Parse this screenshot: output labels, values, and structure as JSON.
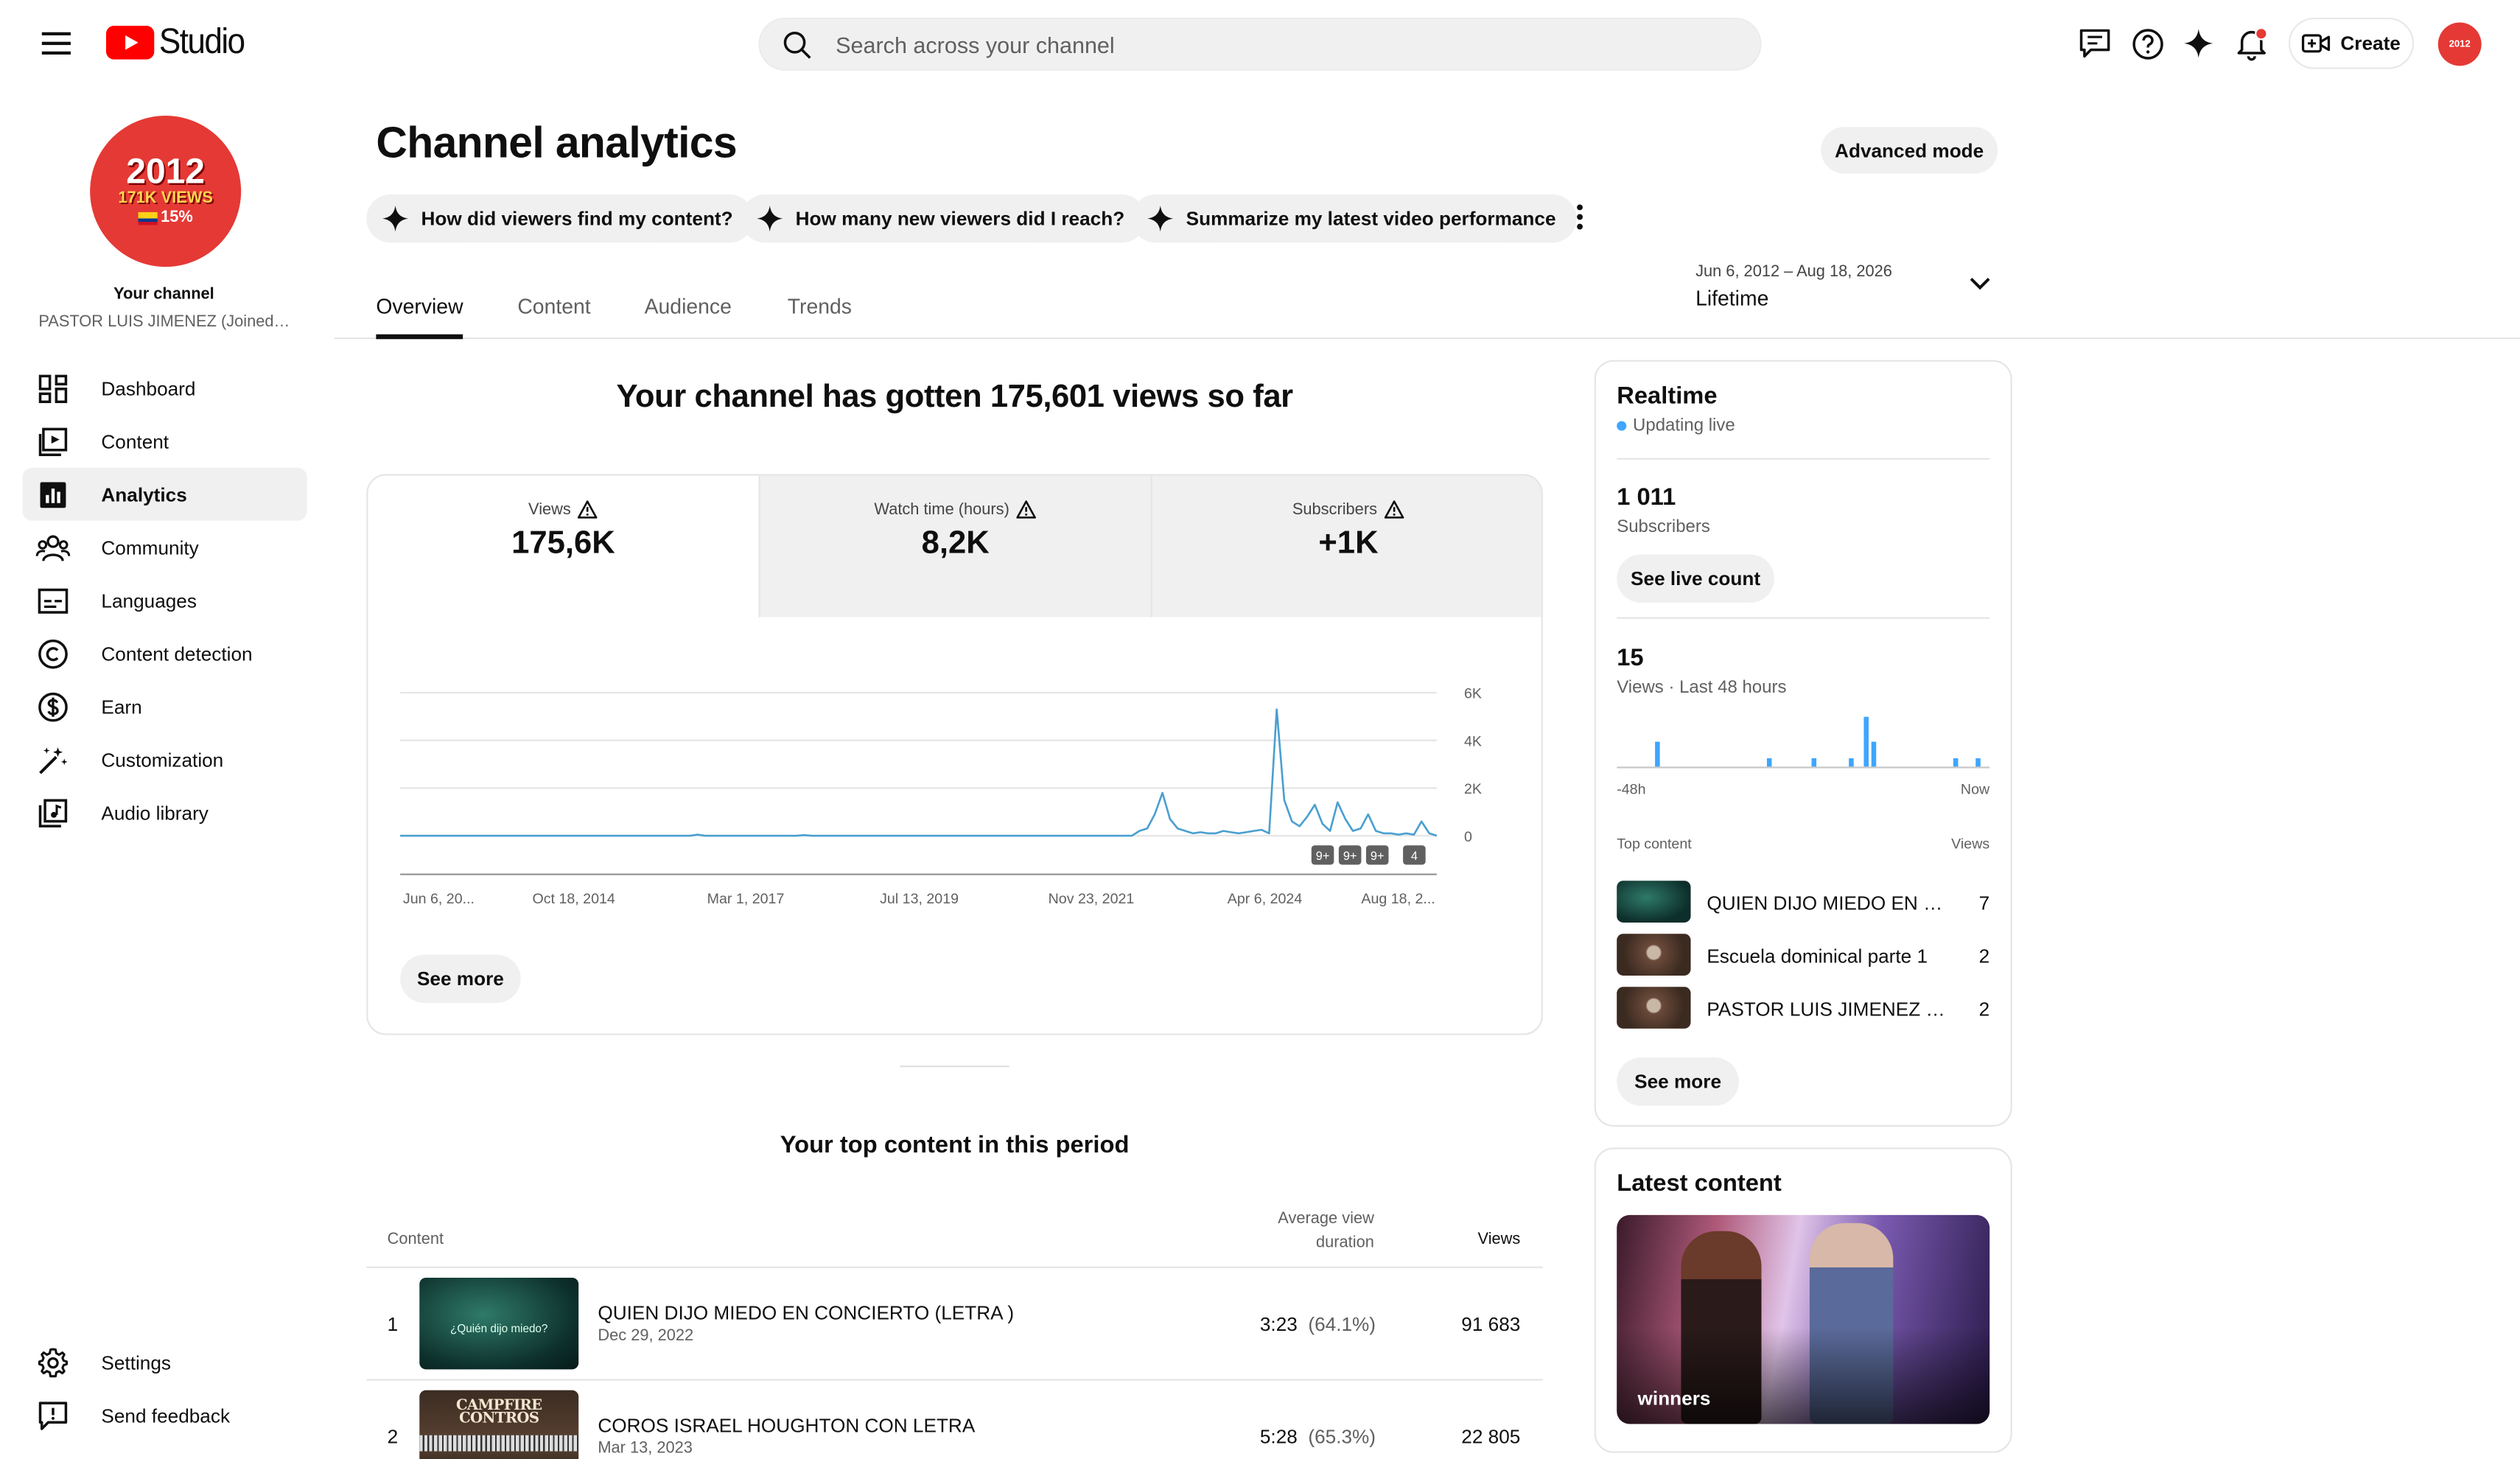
{
  "app": {
    "logo_text": "Studio"
  },
  "header": {
    "search_placeholder": "Search across your channel",
    "create_label": "Create",
    "avatar_text": "2012"
  },
  "sidebar": {
    "avatar": {
      "year": "2012",
      "views": "171K VIEWS",
      "pct": "15%"
    },
    "your_channel": "Your channel",
    "channel_name": "PASTOR LUIS JIMENEZ (Joined J...",
    "items": [
      {
        "label": "Dashboard",
        "icon": "dashboard-icon"
      },
      {
        "label": "Content",
        "icon": "content-icon"
      },
      {
        "label": "Analytics",
        "icon": "analytics-icon"
      },
      {
        "label": "Community",
        "icon": "community-icon"
      },
      {
        "label": "Languages",
        "icon": "subtitles-icon"
      },
      {
        "label": "Content detection",
        "icon": "copyright-icon"
      },
      {
        "label": "Earn",
        "icon": "dollar-icon"
      },
      {
        "label": "Customization",
        "icon": "magic-wand-icon"
      },
      {
        "label": "Audio library",
        "icon": "audio-library-icon"
      }
    ],
    "bottom": [
      {
        "label": "Settings",
        "icon": "gear-icon"
      },
      {
        "label": "Send feedback",
        "icon": "feedback-icon"
      }
    ]
  },
  "page": {
    "title": "Channel analytics",
    "advanced_mode": "Advanced mode",
    "chips": [
      "How did viewers find my content?",
      "How many new viewers did I reach?",
      "Summarize my latest video performance"
    ],
    "date_range": "Jun 6, 2012 – Aug 18, 2026",
    "date_period": "Lifetime",
    "tabs": [
      "Overview",
      "Content",
      "Audience",
      "Trends"
    ],
    "headline": "Your channel has gotten 175,601 views so far"
  },
  "metrics": [
    {
      "label": "Views",
      "value": "175,6K"
    },
    {
      "label": "Watch time (hours)",
      "value": "8,2K"
    },
    {
      "label": "Subscribers",
      "value": "+1K"
    }
  ],
  "chart_data": {
    "type": "line",
    "title": "",
    "xlabel": "",
    "ylabel": "",
    "series": [
      {
        "values": [
          0,
          0,
          0,
          0,
          0,
          0,
          0,
          0,
          0,
          0,
          0,
          0,
          0,
          0,
          0,
          0,
          0,
          0,
          0,
          0,
          0,
          0,
          0,
          0,
          0,
          0,
          0,
          0,
          0,
          0,
          0,
          0,
          0,
          0,
          0,
          0,
          0,
          0,
          0,
          50,
          0,
          0,
          0,
          0,
          0,
          0,
          0,
          0,
          0,
          0,
          0,
          0,
          0,
          30,
          0,
          0,
          0,
          0,
          0,
          0,
          0,
          0,
          0,
          0,
          0,
          0,
          0,
          0,
          0,
          0,
          0,
          0,
          0,
          0,
          0,
          0,
          0,
          0,
          0,
          0,
          0,
          0,
          0,
          0,
          0,
          0,
          0,
          0,
          0,
          0,
          0,
          0,
          0,
          0,
          0,
          0,
          0,
          200,
          300,
          900,
          1800,
          700,
          300,
          200,
          100,
          150,
          100,
          100,
          200,
          150,
          100,
          150,
          200,
          250,
          100,
          5300,
          1500,
          600,
          400,
          800,
          1300,
          500,
          200,
          1400,
          700,
          200,
          300,
          900,
          200,
          100,
          100,
          50,
          100,
          50,
          600,
          100,
          0
        ]
      }
    ],
    "x_ticks": [
      "Jun 6, 20...",
      "Oct 18, 2014",
      "Mar 1, 2017",
      "Jul 13, 2019",
      "Nov 23, 2021",
      "Apr 6, 2024",
      "Aug 18, 2..."
    ],
    "y_ticks": [
      "0",
      "2K",
      "4K",
      "6K"
    ],
    "ylim": [
      0,
      6000
    ],
    "grid": true,
    "markers": [
      "9+",
      "9+",
      "9+",
      "4"
    ]
  },
  "overview": {
    "see_more": "See more"
  },
  "top_content": {
    "title": "Your top content in this period",
    "col_content": "Content",
    "col_avd_line1": "Average view",
    "col_avd_line2": "duration",
    "col_views": "Views",
    "rows": [
      {
        "rank": "1",
        "title": "QUIEN DIJO MIEDO EN CONCIERTO (LETRA )",
        "date": "Dec 29, 2022",
        "duration": "3:23",
        "pct": "(64.1%)",
        "views": "91 683",
        "thumb_text": "¿Quién dijo miedo?"
      },
      {
        "rank": "2",
        "title": "COROS ISRAEL HOUGHTON CON LETRA",
        "date": "Mar 13, 2023",
        "duration": "5:28",
        "pct": "(65.3%)",
        "views": "22 805",
        "thumb_text": "CAMPFIRE CONTROS"
      }
    ]
  },
  "realtime": {
    "title": "Realtime",
    "status": "Updating live",
    "subs_value": "1 011",
    "subs_label": "Subscribers",
    "see_live": "See live count",
    "views_value": "15",
    "views_label": "Views · Last 48 hours",
    "bars": [
      0,
      0,
      0,
      0,
      0,
      3,
      0,
      0,
      0,
      0,
      0,
      0,
      0,
      0,
      0,
      0,
      0,
      0,
      0,
      0,
      1,
      0,
      0,
      0,
      0,
      0,
      1,
      0,
      0,
      0,
      0,
      1,
      0,
      6,
      3,
      0,
      0,
      0,
      0,
      0,
      0,
      0,
      0,
      0,
      0,
      1,
      0,
      0,
      1,
      0
    ],
    "axis_left": "-48h",
    "axis_right": "Now",
    "top_content_label": "Top content",
    "views_col": "Views",
    "items": [
      {
        "title": "QUIEN DIJO MIEDO EN CO...",
        "views": "7"
      },
      {
        "title": "Escuela dominical parte 1",
        "views": "2"
      },
      {
        "title": "PASTOR LUIS JIMENEZ est...",
        "views": "2"
      }
    ],
    "see_more": "See more"
  },
  "latest": {
    "title": "Latest content",
    "caption": "winners"
  },
  "colors": {
    "accent": "#3ea6ff",
    "chart_line": "#4a9fd0",
    "brand_red": "#ff0000",
    "avatar_red": "#e53935"
  }
}
